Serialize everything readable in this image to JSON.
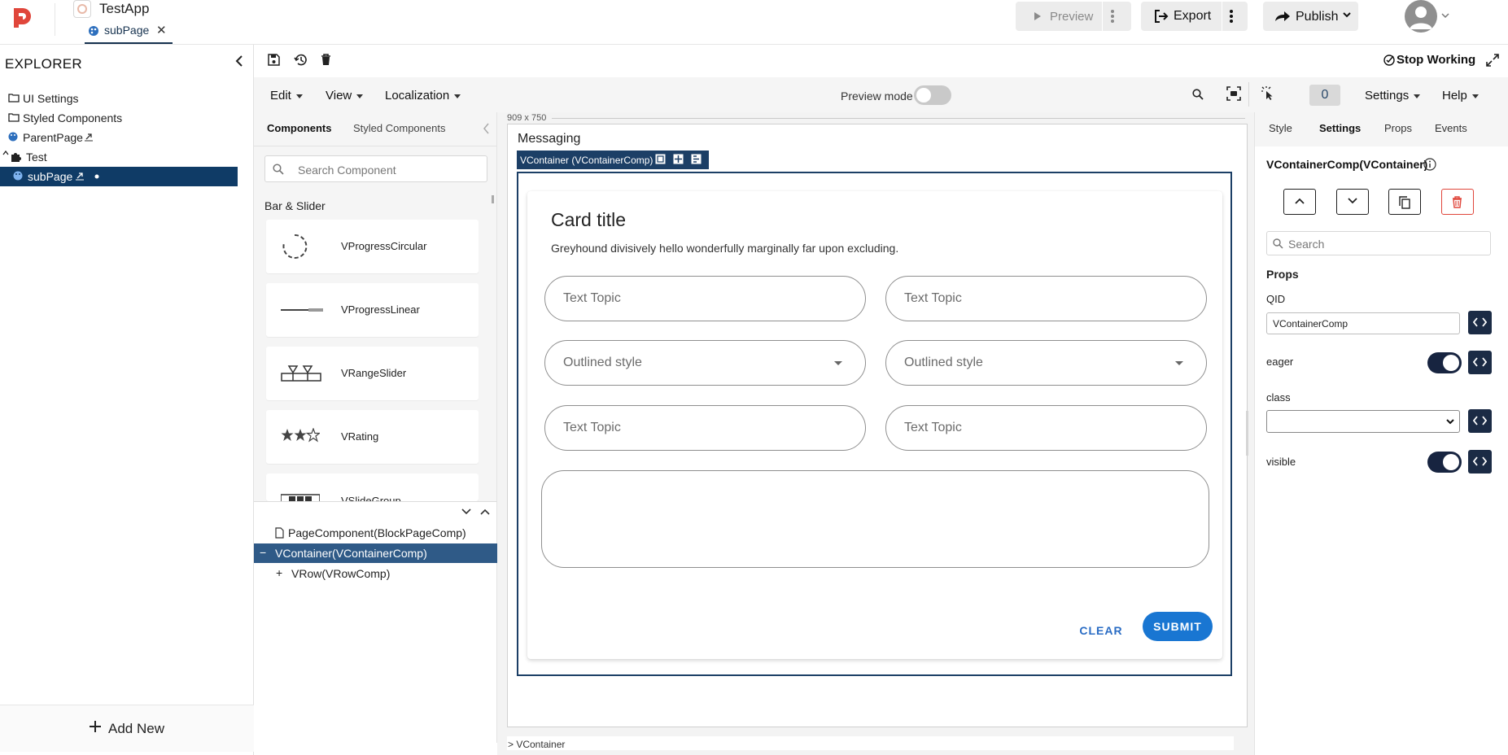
{
  "app": {
    "title": "TestApp",
    "page_tab": "subPage"
  },
  "header": {
    "preview_label": "Preview",
    "export_label": "Export",
    "publish_label": "Publish"
  },
  "explorer": {
    "title": "EXPLORER",
    "items": [
      {
        "label": "UI Settings",
        "icon": "folder-icon"
      },
      {
        "label": "Styled Components",
        "icon": "folder-icon"
      },
      {
        "label": "ParentPage",
        "icon": "palette-icon"
      },
      {
        "label": "Test",
        "icon": "puzzle-icon"
      },
      {
        "label": "subPage",
        "icon": "palette-icon",
        "selected": true
      }
    ],
    "add_new": "Add New"
  },
  "toolbar": {
    "stop_working": "Stop Working",
    "menus": {
      "edit": "Edit",
      "view": "View",
      "localization": "Localization",
      "settings": "Settings",
      "help": "Help"
    },
    "preview_mode": "Preview mode",
    "preview_mode_on": false,
    "counter": "0"
  },
  "components_panel": {
    "tabs": [
      "Components",
      "Styled Components"
    ],
    "search_placeholder": "Search Component",
    "category": "Bar & Slider",
    "items": [
      "VProgressCircular",
      "VProgressLinear",
      "VRangeSlider",
      "VRating",
      "VSlideGroup"
    ]
  },
  "component_tree": {
    "rows": [
      {
        "label": "PageComponent(BlockPageComp)"
      },
      {
        "label": "VContainer(VContainerComp)",
        "prefix": "−",
        "selected": true
      },
      {
        "label": "VRow(VRowComp)",
        "prefix": "+"
      }
    ]
  },
  "canvas": {
    "size": "909 x 750",
    "page_title": "Messaging",
    "selected_tag": "VContainer (VContainerComp)",
    "breadcrumb": "> VContainer",
    "card": {
      "title": "Card title",
      "subtitle": "Greyhound divisively hello wonderfully marginally far upon excluding.",
      "fields": [
        "Text Topic",
        "Text Topic",
        "Outlined style",
        "Outlined style",
        "Text Topic",
        "Text Topic"
      ],
      "clear": "CLEAR",
      "submit": "SUBMIT"
    }
  },
  "right_panel": {
    "tabs": [
      "Style",
      "Settings",
      "Props",
      "Events"
    ],
    "active_tab": "Settings",
    "title": "VContainerComp(VContainer)",
    "search_placeholder": "Search",
    "props_heading": "Props",
    "qid_label": "QID",
    "qid_value": "VContainerComp",
    "eager_label": "eager",
    "eager_on": true,
    "class_label": "class",
    "visible_label": "visible",
    "visible_on": true
  },
  "colors": {
    "brand_red": "#e0463b",
    "selected_bg": "#0f3b66",
    "primary": "#1976d2",
    "dark_switch": "#172440"
  }
}
